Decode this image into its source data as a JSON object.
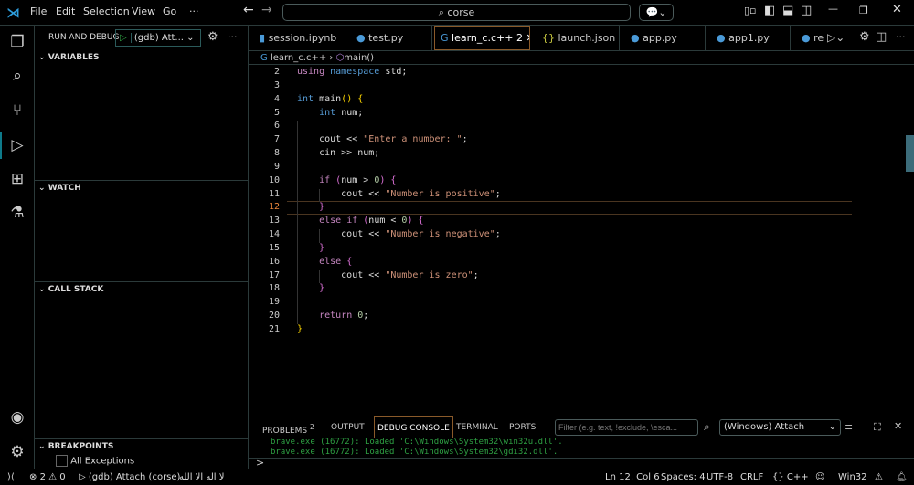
{
  "menu": [
    "File",
    "Edit",
    "Selection",
    "View",
    "Go",
    "···"
  ],
  "search": "corse",
  "run_debug": {
    "title": "RUN AND DEBUG",
    "config": "(gdb) Att..."
  },
  "sections": {
    "variables": "VARIABLES",
    "watch": "WATCH",
    "call_stack": "CALL STACK",
    "breakpoints": "BREAKPOINTS"
  },
  "breakpoint_items": [
    {
      "label": "All Exceptions",
      "checked": false
    }
  ],
  "tabs": [
    {
      "label": "session.ipynb",
      "icon": "notebook-icon"
    },
    {
      "label": "test.py",
      "icon": "python-icon"
    },
    {
      "label": "learn_c.c++",
      "badge": "2",
      "icon": "cpp-icon",
      "active": true
    },
    {
      "label": "launch.json",
      "icon": "json-icon"
    },
    {
      "label": "app.py",
      "icon": "python-icon"
    },
    {
      "label": "app1.py",
      "icon": "python-icon"
    },
    {
      "label": "re",
      "icon": "python-icon"
    }
  ],
  "breadcrumb": {
    "file": "learn_c.c++",
    "symbol": "main()"
  },
  "code": [
    {
      "n": "2",
      "t": [
        [
          "kw",
          "using "
        ],
        [
          "ty",
          "namespace "
        ],
        [
          "id",
          "std;"
        ]
      ]
    },
    {
      "n": "3",
      "t": []
    },
    {
      "n": "4",
      "t": [
        [
          "ty",
          "int "
        ],
        [
          "id",
          "main"
        ],
        [
          "br2",
          "()"
        ],
        [
          "id",
          " "
        ],
        [
          "br2",
          "{"
        ]
      ]
    },
    {
      "n": "5",
      "t": [
        [
          "id",
          "    "
        ],
        [
          "ty",
          "int "
        ],
        [
          "id",
          "num;"
        ]
      ]
    },
    {
      "n": "6",
      "t": []
    },
    {
      "n": "7",
      "t": [
        [
          "id",
          "    cout << "
        ],
        [
          "st",
          "\"Enter a number: \""
        ],
        [
          "id",
          ";"
        ]
      ]
    },
    {
      "n": "8",
      "t": [
        [
          "id",
          "    cin >> num;"
        ]
      ]
    },
    {
      "n": "9",
      "t": []
    },
    {
      "n": "10",
      "t": [
        [
          "id",
          "    "
        ],
        [
          "kw",
          "if "
        ],
        [
          "br1",
          "("
        ],
        [
          "id",
          "num > "
        ],
        [
          "nm",
          "0"
        ],
        [
          "br1",
          ")"
        ],
        [
          "id",
          " "
        ],
        [
          "br1",
          "{"
        ]
      ]
    },
    {
      "n": "11",
      "t": [
        [
          "id",
          "        cout << "
        ],
        [
          "st",
          "\"Number is positive\""
        ],
        [
          "id",
          ";"
        ]
      ]
    },
    {
      "n": "12",
      "t": [
        [
          "id",
          "    "
        ],
        [
          "br1",
          "}"
        ]
      ],
      "current": true
    },
    {
      "n": "13",
      "t": [
        [
          "id",
          "    "
        ],
        [
          "kw",
          "else if "
        ],
        [
          "br1",
          "("
        ],
        [
          "id",
          "num < "
        ],
        [
          "nm",
          "0"
        ],
        [
          "br1",
          ")"
        ],
        [
          "id",
          " "
        ],
        [
          "br1",
          "{"
        ]
      ]
    },
    {
      "n": "14",
      "t": [
        [
          "id",
          "        cout << "
        ],
        [
          "st",
          "\"Number is negative\""
        ],
        [
          "id",
          ";"
        ]
      ]
    },
    {
      "n": "15",
      "t": [
        [
          "id",
          "    "
        ],
        [
          "br1",
          "}"
        ]
      ]
    },
    {
      "n": "16",
      "t": [
        [
          "id",
          "    "
        ],
        [
          "kw",
          "else "
        ],
        [
          "br1",
          "{"
        ]
      ]
    },
    {
      "n": "17",
      "t": [
        [
          "id",
          "        cout << "
        ],
        [
          "st",
          "\"Number is zero\""
        ],
        [
          "id",
          ";"
        ]
      ]
    },
    {
      "n": "18",
      "t": [
        [
          "id",
          "    "
        ],
        [
          "br1",
          "}"
        ]
      ]
    },
    {
      "n": "19",
      "t": []
    },
    {
      "n": "20",
      "t": [
        [
          "id",
          "    "
        ],
        [
          "kw",
          "return "
        ],
        [
          "nm",
          "0"
        ],
        [
          "id",
          ";"
        ]
      ]
    },
    {
      "n": "21",
      "t": [
        [
          "br2",
          "}"
        ]
      ]
    }
  ],
  "panel": {
    "tabs": [
      "PROBLEMS",
      "OUTPUT",
      "DEBUG CONSOLE",
      "TERMINAL",
      "PORTS"
    ],
    "problems_count": "2",
    "filter_placeholder": "Filter (e.g. text, !exclude, \\esca...",
    "target": "(Windows) Attach",
    "console": [
      "brave.exe (16772): Loaded 'C:\\Windows\\System32\\win32u.dll'.",
      "brave.exe (16772): Loaded 'C:\\Windows\\System32\\gdi32.dll'."
    ],
    "prompt": ">"
  },
  "status": {
    "errors": "2",
    "warnings": "0",
    "debug": "(gdb) Attach (corse)",
    "text": "لا اله الا الله",
    "position": "Ln 12, Col 6",
    "spaces": "Spaces: 4",
    "encoding": "UTF-8",
    "eol": "CRLF",
    "language": "C++",
    "platform": "Win32"
  },
  "colors": {
    "accent": "#0e7a8a",
    "active_tab_border": "#8a5a2a",
    "console_text": "#2ea043"
  }
}
